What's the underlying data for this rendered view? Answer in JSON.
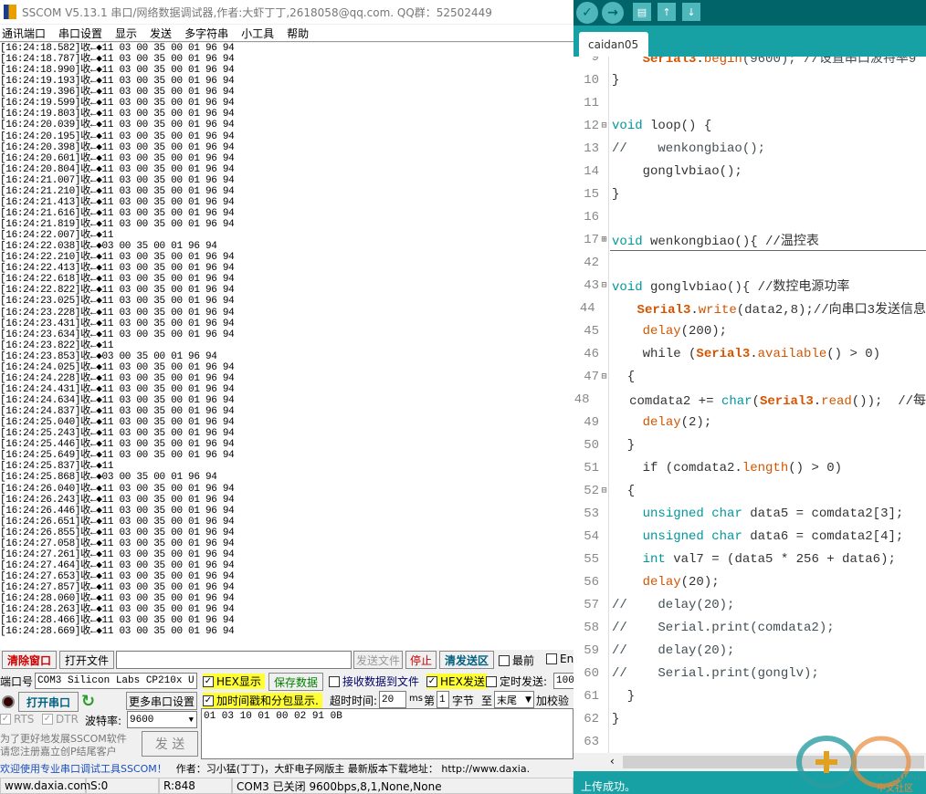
{
  "sscom": {
    "title": "SSCOM V5.13.1 串口/网络数据调试器,作者:大虾丁丁,2618058@qq.com. QQ群：52502449",
    "menu": [
      "通讯端口",
      "串口设置",
      "显示",
      "发送",
      "多字符串",
      "小工具",
      "帮助"
    ],
    "log": [
      [
        "16:24:18.582",
        "11 03 00 35 00 01 96 94"
      ],
      [
        "16:24:18.787",
        "11 03 00 35 00 01 96 94"
      ],
      [
        "16:24:18.990",
        "11 03 00 35 00 01 96 94"
      ],
      [
        "16:24:19.193",
        "11 03 00 35 00 01 96 94"
      ],
      [
        "16:24:19.396",
        "11 03 00 35 00 01 96 94"
      ],
      [
        "16:24:19.599",
        "11 03 00 35 00 01 96 94"
      ],
      [
        "16:24:19.803",
        "11 03 00 35 00 01 96 94"
      ],
      [
        "16:24:20.039",
        "11 03 00 35 00 01 96 94"
      ],
      [
        "16:24:20.195",
        "11 03 00 35 00 01 96 94"
      ],
      [
        "16:24:20.398",
        "11 03 00 35 00 01 96 94"
      ],
      [
        "16:24:20.601",
        "11 03 00 35 00 01 96 94"
      ],
      [
        "16:24:20.804",
        "11 03 00 35 00 01 96 94"
      ],
      [
        "16:24:21.007",
        "11 03 00 35 00 01 96 94"
      ],
      [
        "16:24:21.210",
        "11 03 00 35 00 01 96 94"
      ],
      [
        "16:24:21.413",
        "11 03 00 35 00 01 96 94"
      ],
      [
        "16:24:21.616",
        "11 03 00 35 00 01 96 94"
      ],
      [
        "16:24:21.819",
        "11 03 00 35 00 01 96 94"
      ],
      [
        "16:24:22.007",
        "11"
      ],
      [
        "16:24:22.038",
        "03 00 35 00 01 96 94"
      ],
      [
        "16:24:22.210",
        "11 03 00 35 00 01 96 94"
      ],
      [
        "16:24:22.413",
        "11 03 00 35 00 01 96 94"
      ],
      [
        "16:24:22.618",
        "11 03 00 35 00 01 96 94"
      ],
      [
        "16:24:22.822",
        "11 03 00 35 00 01 96 94"
      ],
      [
        "16:24:23.025",
        "11 03 00 35 00 01 96 94"
      ],
      [
        "16:24:23.228",
        "11 03 00 35 00 01 96 94"
      ],
      [
        "16:24:23.431",
        "11 03 00 35 00 01 96 94"
      ],
      [
        "16:24:23.634",
        "11 03 00 35 00 01 96 94"
      ],
      [
        "16:24:23.822",
        "11"
      ],
      [
        "16:24:23.853",
        "03 00 35 00 01 96 94"
      ],
      [
        "16:24:24.025",
        "11 03 00 35 00 01 96 94"
      ],
      [
        "16:24:24.228",
        "11 03 00 35 00 01 96 94"
      ],
      [
        "16:24:24.431",
        "11 03 00 35 00 01 96 94"
      ],
      [
        "16:24:24.634",
        "11 03 00 35 00 01 96 94"
      ],
      [
        "16:24:24.837",
        "11 03 00 35 00 01 96 94"
      ],
      [
        "16:24:25.040",
        "11 03 00 35 00 01 96 94"
      ],
      [
        "16:24:25.243",
        "11 03 00 35 00 01 96 94"
      ],
      [
        "16:24:25.446",
        "11 03 00 35 00 01 96 94"
      ],
      [
        "16:24:25.649",
        "11 03 00 35 00 01 96 94"
      ],
      [
        "16:24:25.837",
        "11"
      ],
      [
        "16:24:25.868",
        "03 00 35 00 01 96 94"
      ],
      [
        "16:24:26.040",
        "11 03 00 35 00 01 96 94"
      ],
      [
        "16:24:26.243",
        "11 03 00 35 00 01 96 94"
      ],
      [
        "16:24:26.446",
        "11 03 00 35 00 01 96 94"
      ],
      [
        "16:24:26.651",
        "11 03 00 35 00 01 96 94"
      ],
      [
        "16:24:26.855",
        "11 03 00 35 00 01 96 94"
      ],
      [
        "16:24:27.058",
        "11 03 00 35 00 01 96 94"
      ],
      [
        "16:24:27.261",
        "11 03 00 35 00 01 96 94"
      ],
      [
        "16:24:27.464",
        "11 03 00 35 00 01 96 94"
      ],
      [
        "16:24:27.653",
        "11 03 00 35 00 01 96 94"
      ],
      [
        "16:24:27.857",
        "11 03 00 35 00 01 96 94"
      ],
      [
        "16:24:28.060",
        "11 03 00 35 00 01 96 94"
      ],
      [
        "16:24:28.263",
        "11 03 00 35 00 01 96 94"
      ],
      [
        "16:24:28.466",
        "11 03 00 35 00 01 96 94"
      ],
      [
        "16:24:28.669",
        "11 03 00 35 00 01 96 94"
      ]
    ],
    "log_prefix": "收←◆",
    "clear_btn": "清除窗口",
    "open_file_btn": "打开文件",
    "file_path": "",
    "send_file_btn": "发送文件",
    "stop_btn": "停止",
    "clear_send_btn": "清发送区",
    "topmost": "最前",
    "en": "En",
    "port_label": "端口号",
    "port_value": "COM3 Silicon Labs CP210x U",
    "hex_display": "HEX显示",
    "save_data": "保存数据",
    "recv_to_file": "接收数据到文件",
    "hex_send": "HEX发送",
    "timed_send": "定时发送:",
    "timed_value": "100",
    "open_port": "打开串口",
    "more_settings": "更多串口设置",
    "timestamp": "加时间戳和分包显示.",
    "timeout_label": "超时时间:",
    "timeout_value": "20",
    "ms": "ms",
    "byte_from_label": "第",
    "byte_from": "1",
    "byte_label": "字节",
    "to_label": "至",
    "to_value": "末尾",
    "checksum": "加校验",
    "rts": "RTS",
    "dtr": "DTR",
    "baud_label": "波特率:",
    "baud_value": "9600",
    "send_text": "01 03 10 01 00 02 91 0B",
    "promo1": "为了更好地发展SSCOM软件",
    "promo2": "请您注册嘉立创P结尾客户",
    "send_btn": "发  送",
    "marquee_a": "欢迎使用专业串口调试工具SSCOM！",
    "marquee_b": "作者：习小猛(丁丁)，大虾电子网版主  最新版本下载地址： http://www.daxia.",
    "status": {
      "site": "www.daxia.com",
      "sent": "S:0",
      "recv": "R:848",
      "port_state": "COM3 已关闭  9600bps,8,1,None,None"
    }
  },
  "arduino": {
    "tab": "caidan05",
    "colors": {
      "toolbar": "#006468",
      "teal": "#17a1a5",
      "keyword": "#00979c",
      "function": "#d35400"
    },
    "code": [
      {
        "n": "9",
        "t": [
          [
            "    ",
            ""
          ],
          [
            "Serial3",
            "s"
          ],
          [
            ".",
            ""
          ],
          [
            "begin",
            "f"
          ],
          [
            "(9600); //设置串口波特率9",
            "c"
          ]
        ]
      },
      {
        "n": "10",
        "t": [
          [
            "}",
            ""
          ]
        ]
      },
      {
        "n": "11",
        "t": []
      },
      {
        "n": "12",
        "fold": "⊟",
        "t": [
          [
            "void",
            "k"
          ],
          [
            " loop() {",
            ""
          ]
        ]
      },
      {
        "n": "13",
        "t": [
          [
            "//    wenkongbiao();",
            "c"
          ]
        ]
      },
      {
        "n": "14",
        "t": [
          [
            "    gonglvbiao();",
            ""
          ]
        ]
      },
      {
        "n": "15",
        "t": [
          [
            "}",
            ""
          ]
        ]
      },
      {
        "n": "16",
        "t": []
      },
      {
        "n": "17",
        "fold": "⊞",
        "t": [
          [
            "void",
            "k"
          ],
          [
            " wenkongbiao(){ //温控表",
            ""
          ]
        ]
      },
      {
        "n": "42",
        "t": []
      },
      {
        "n": "43",
        "fold": "⊟",
        "t": [
          [
            "void",
            "k"
          ],
          [
            " gonglvbiao(){ //数控电源功率",
            ""
          ]
        ]
      },
      {
        "n": "44",
        "t": [
          [
            "    ",
            ""
          ],
          [
            "Serial3",
            "s"
          ],
          [
            ".",
            ""
          ],
          [
            "write",
            "f"
          ],
          [
            "(data2,8);//向串口3发送信息",
            ""
          ]
        ]
      },
      {
        "n": "45",
        "t": [
          [
            "    ",
            ""
          ],
          [
            "delay",
            "f"
          ],
          [
            "(200);",
            ""
          ]
        ]
      },
      {
        "n": "46",
        "t": [
          [
            "    while (",
            ""
          ],
          [
            "Serial3",
            "s"
          ],
          [
            ".",
            ""
          ],
          [
            "available",
            "f"
          ],
          [
            "() > 0)",
            ""
          ]
        ]
      },
      {
        "n": "47",
        "fold": "⊟",
        "t": [
          [
            "  {",
            ""
          ]
        ]
      },
      {
        "n": "48",
        "t": [
          [
            "    comdata2 += ",
            ""
          ],
          [
            "char",
            "k"
          ],
          [
            "(",
            ""
          ],
          [
            "Serial3",
            "s"
          ],
          [
            ".",
            ""
          ],
          [
            "read",
            "f"
          ],
          [
            "());  //每",
            ""
          ]
        ]
      },
      {
        "n": "49",
        "t": [
          [
            "    ",
            ""
          ],
          [
            "delay",
            "f"
          ],
          [
            "(2);",
            ""
          ]
        ]
      },
      {
        "n": "50",
        "t": [
          [
            "  }",
            ""
          ]
        ]
      },
      {
        "n": "51",
        "t": [
          [
            "    if (comdata2.",
            ""
          ],
          [
            "length",
            "f"
          ],
          [
            "() > 0)",
            ""
          ]
        ]
      },
      {
        "n": "52",
        "fold": "⊟",
        "t": [
          [
            "  {",
            ""
          ]
        ]
      },
      {
        "n": "53",
        "t": [
          [
            "    ",
            ""
          ],
          [
            "unsigned",
            "k"
          ],
          [
            " ",
            ""
          ],
          [
            "char",
            "k"
          ],
          [
            " data5 = comdata2[3];",
            ""
          ]
        ]
      },
      {
        "n": "54",
        "t": [
          [
            "    ",
            ""
          ],
          [
            "unsigned",
            "k"
          ],
          [
            " ",
            ""
          ],
          [
            "char",
            "k"
          ],
          [
            " data6 = comdata2[4];",
            ""
          ]
        ]
      },
      {
        "n": "55",
        "t": [
          [
            "    ",
            ""
          ],
          [
            "int",
            "k"
          ],
          [
            " val7 = (data5 * 256 + data6);",
            ""
          ]
        ]
      },
      {
        "n": "56",
        "t": [
          [
            "    ",
            ""
          ],
          [
            "delay",
            "f"
          ],
          [
            "(20);",
            ""
          ]
        ]
      },
      {
        "n": "57",
        "t": [
          [
            "//    delay(20);",
            "c"
          ]
        ]
      },
      {
        "n": "58",
        "t": [
          [
            "//    Serial.print(comdata2);",
            "c"
          ]
        ]
      },
      {
        "n": "59",
        "t": [
          [
            "//    delay(20);",
            "c"
          ]
        ]
      },
      {
        "n": "60",
        "t": [
          [
            "//    Serial.print(gonglv);",
            "c"
          ]
        ]
      },
      {
        "n": "61",
        "t": [
          [
            "  }",
            ""
          ]
        ]
      },
      {
        "n": "62",
        "t": [
          [
            "}",
            ""
          ]
        ]
      },
      {
        "n": "63",
        "t": []
      }
    ],
    "status": "上传成功。",
    "watermark": "ARDUINO 中文社区"
  }
}
